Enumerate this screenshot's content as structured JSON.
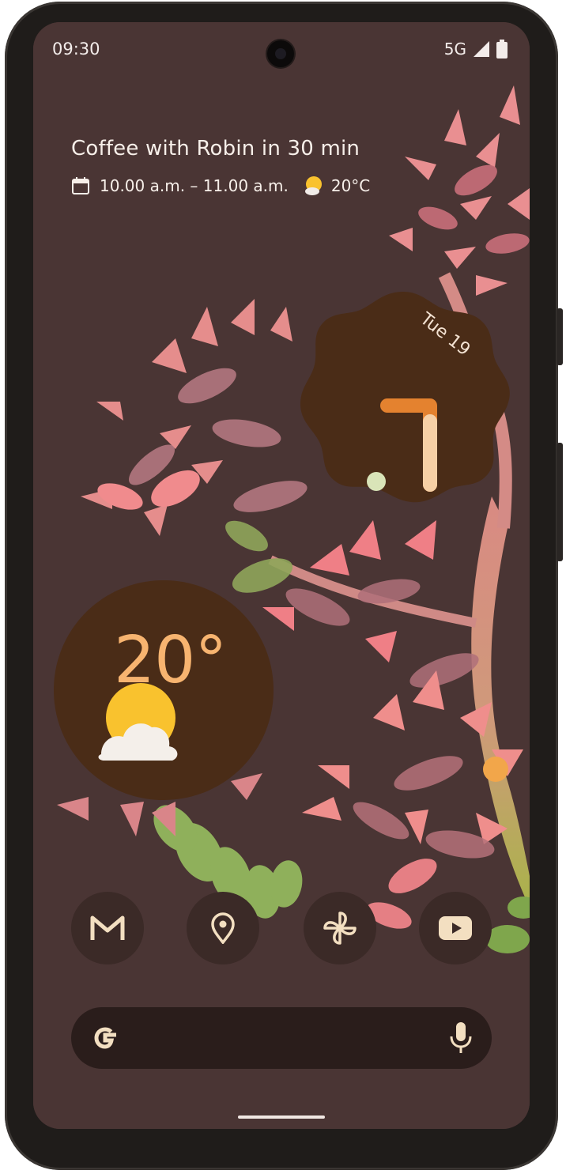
{
  "status_bar": {
    "time": "09:30",
    "network": "5G",
    "signal_icon": "signal-icon",
    "battery_icon": "battery-icon"
  },
  "at_a_glance": {
    "event_title": "Coffee with Robin in 30 min",
    "event_time": "10.00 a.m. – 11.00 a.m.",
    "temperature": "20°C",
    "calendar_icon": "calendar-icon",
    "weather_icon": "partly-sunny-icon"
  },
  "clock_widget": {
    "date": "Tue 19",
    "time_shown": "7:00"
  },
  "weather_widget": {
    "temperature": "20°",
    "icon": "partly-sunny-icon"
  },
  "dock": {
    "apps": [
      {
        "name": "Gmail",
        "icon": "gmail-icon"
      },
      {
        "name": "Maps",
        "icon": "maps-pin-icon"
      },
      {
        "name": "Pinwheel",
        "icon": "pinwheel-icon"
      },
      {
        "name": "YouTube",
        "icon": "youtube-icon"
      }
    ]
  },
  "search": {
    "logo_icon": "google-g-icon",
    "mic_icon": "microphone-icon"
  },
  "colors": {
    "wallpaper": "#4a3534",
    "widget_bg": "#4a2c17",
    "accent_orange": "#e4822f",
    "temp_text": "#f7b470",
    "dock_icon_bg": "#3b2a27",
    "icon_cream": "#f3dfc1"
  }
}
